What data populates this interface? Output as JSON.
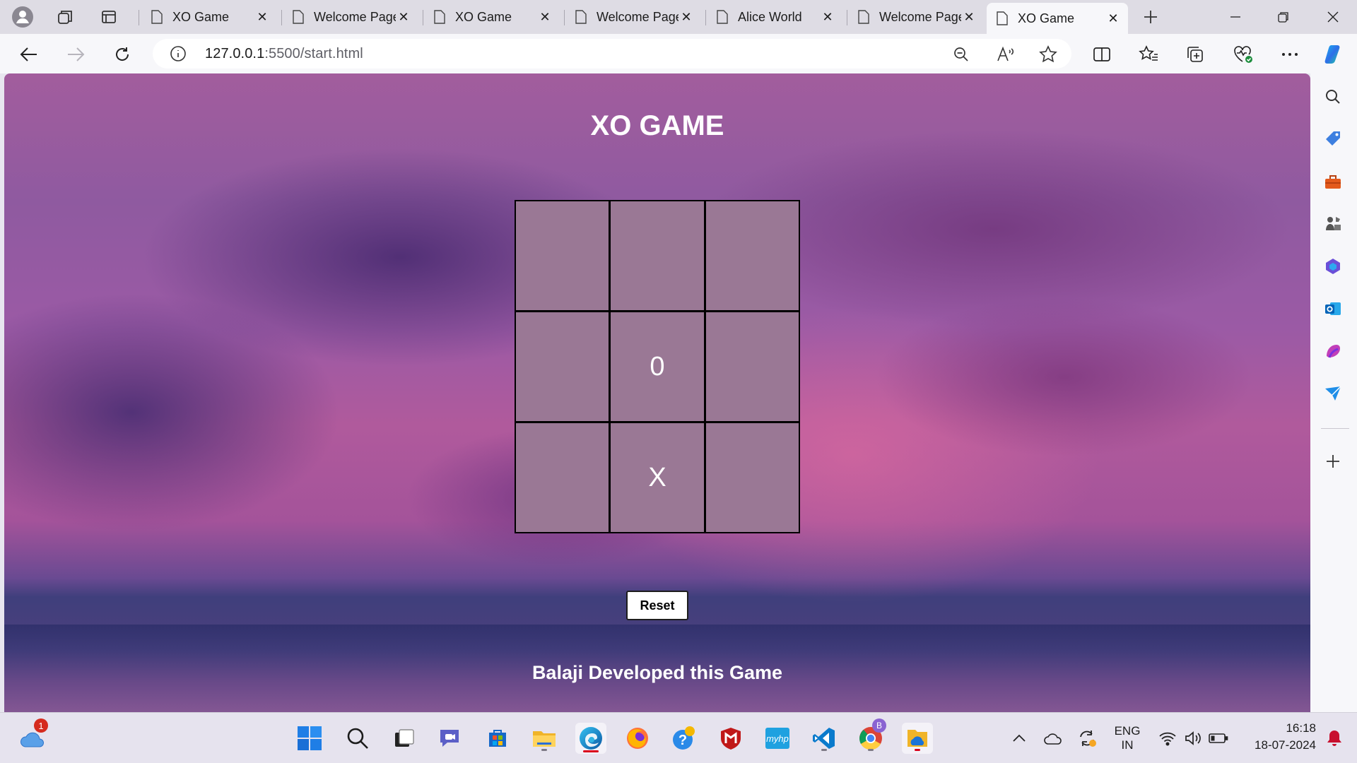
{
  "browser": {
    "tabs": [
      {
        "label": "XO Game",
        "active": false
      },
      {
        "label": "Welcome Page",
        "active": false
      },
      {
        "label": "XO Game",
        "active": false
      },
      {
        "label": "Welcome Page",
        "active": false
      },
      {
        "label": "Alice World",
        "active": false
      },
      {
        "label": "Welcome Page",
        "active": false
      },
      {
        "label": "XO Game",
        "active": true
      }
    ],
    "url_host": "127.0.0.1",
    "url_path": ":5500/start.html"
  },
  "page": {
    "title": "XO GAME",
    "board": [
      "",
      "",
      "",
      "",
      "0",
      "",
      "",
      "X",
      ""
    ],
    "reset_label": "Reset",
    "credit": "Balaji Developed this Game"
  },
  "taskbar": {
    "weather_badge": "1",
    "lang_top": "ENG",
    "lang_bottom": "IN",
    "time": "16:18",
    "date": "18-07-2024",
    "chrome_badge": "B"
  },
  "colors": {
    "cell": "#9a7895",
    "grid": "#000000",
    "accent": "#0c59a4"
  }
}
